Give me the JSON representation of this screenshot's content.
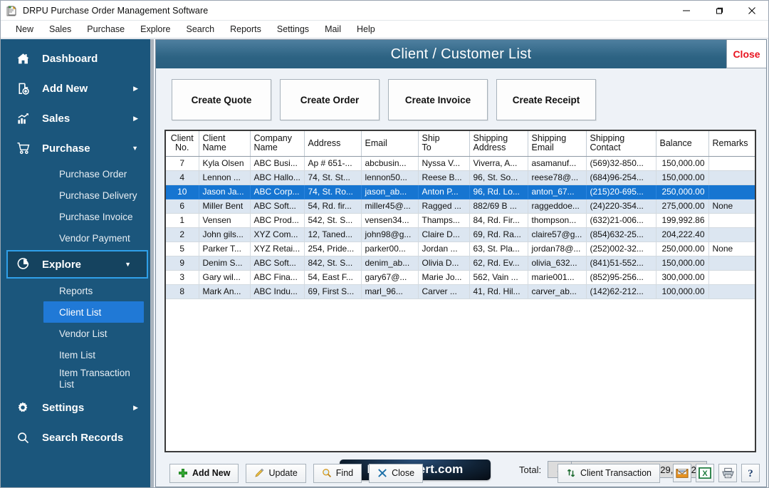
{
  "window": {
    "title": "DRPU Purchase Order Management Software",
    "app_icon": "app-icon",
    "minimize": "—",
    "maximize": "❐",
    "close": "✕"
  },
  "menubar": {
    "items": [
      {
        "label": "New"
      },
      {
        "label": "Sales"
      },
      {
        "label": "Purchase"
      },
      {
        "label": "Explore"
      },
      {
        "label": "Search"
      },
      {
        "label": "Reports"
      },
      {
        "label": "Settings"
      },
      {
        "label": "Mail"
      },
      {
        "label": "Help"
      }
    ]
  },
  "sidebar": {
    "items": [
      {
        "label": "Dashboard",
        "icon": "home-icon",
        "arrow": ""
      },
      {
        "label": "Add New",
        "icon": "file-plus-icon",
        "arrow": "▶"
      },
      {
        "label": "Sales",
        "icon": "bar-chart-icon",
        "arrow": "▶"
      },
      {
        "label": "Purchase",
        "icon": "cart-icon",
        "arrow": "▼"
      }
    ],
    "purchase_sub": [
      {
        "label": "Purchase Order"
      },
      {
        "label": "Purchase Delivery"
      },
      {
        "label": "Purchase Invoice"
      },
      {
        "label": "Vendor Payment"
      }
    ],
    "explore": {
      "label": "Explore",
      "icon": "pie-chart-icon",
      "arrow": "▼"
    },
    "explore_sub": [
      {
        "label": "Reports",
        "selected": false
      },
      {
        "label": "Client List",
        "selected": true
      },
      {
        "label": "Vendor List",
        "selected": false
      },
      {
        "label": "Item List",
        "selected": false
      },
      {
        "label": "Item Transaction",
        "label2": "List",
        "selected": false
      }
    ],
    "settings": {
      "label": "Settings",
      "icon": "gear-icon",
      "arrow": "▶"
    },
    "search_records": {
      "label": "Search Records",
      "icon": "search-icon"
    }
  },
  "panel": {
    "title": "Client / Customer List",
    "close_label": "Close"
  },
  "create_buttons": [
    {
      "label": "Create Quote"
    },
    {
      "label": "Create Order"
    },
    {
      "label": "Create Invoice"
    },
    {
      "label": "Create Receipt"
    }
  ],
  "grid": {
    "columns": [
      {
        "label": "Client No.",
        "l1": "Client",
        "l2": "No.",
        "align": "center"
      },
      {
        "label": "Client Name",
        "l1": "Client",
        "l2": "Name",
        "align": "left"
      },
      {
        "label": "Company Name",
        "l1": "Company",
        "l2": "Name",
        "align": "left"
      },
      {
        "label": "Address",
        "l1": "Address",
        "l2": "",
        "align": "left"
      },
      {
        "label": "Email",
        "l1": "Email",
        "l2": "",
        "align": "left"
      },
      {
        "label": "Ship To",
        "l1": "Ship",
        "l2": "To",
        "align": "left"
      },
      {
        "label": "Shipping Address",
        "l1": "Shipping",
        "l2": "Address",
        "align": "left"
      },
      {
        "label": "Shipping Email",
        "l1": "Shipping",
        "l2": "Email",
        "align": "left"
      },
      {
        "label": "Shipping Contact",
        "l1": "Shipping",
        "l2": "Contact",
        "align": "left"
      },
      {
        "label": "Balance",
        "l1": "Balance",
        "l2": "",
        "align": "left"
      },
      {
        "label": "Remarks",
        "l1": "Remarks",
        "l2": "",
        "align": "left"
      }
    ],
    "rows": [
      {
        "no": "7",
        "name": "Kyla Olsen",
        "company": "ABC Busi...",
        "address": "Ap # 651-...",
        "email": "abcbusin...",
        "ship_to": "Nyssa V...",
        "ship_addr": "Viverra, A...",
        "ship_email": "asamanuf...",
        "ship_contact": "(569)32-850...",
        "balance": "150,000.00",
        "remarks": "",
        "state": "even"
      },
      {
        "no": "4",
        "name": "Lennon ...",
        "company": "ABC Hallo...",
        "address": "74, St. St...",
        "email": "lennon50...",
        "ship_to": "Reese B...",
        "ship_addr": "96, St. So...",
        "ship_email": "reese78@...",
        "ship_contact": "(684)96-254...",
        "balance": "150,000.00",
        "remarks": "",
        "state": "odd"
      },
      {
        "no": "10",
        "name": "Jason Ja...",
        "company": "ABC Corp...",
        "address": "74, St. Ro...",
        "email": "jason_ab...",
        "ship_to": "Anton P...",
        "ship_addr": "96, Rd. Lo...",
        "ship_email": "anton_67...",
        "ship_contact": "(215)20-695...",
        "balance": "250,000.00",
        "remarks": "",
        "state": "sel"
      },
      {
        "no": "6",
        "name": "Miller Bent",
        "company": "ABC Soft...",
        "address": "54, Rd. fir...",
        "email": "miller45@...",
        "ship_to": "Ragged ...",
        "ship_addr": "882/69 B ...",
        "ship_email": "raggeddoe...",
        "ship_contact": "(24)220-354...",
        "balance": "275,000.00",
        "remarks": "None",
        "state": "odd"
      },
      {
        "no": "1",
        "name": "Vensen",
        "company": "ABC Prod...",
        "address": "542, St. S...",
        "email": "vensen34...",
        "ship_to": "Thamps...",
        "ship_addr": "84, Rd. Fir...",
        "ship_email": "thompson...",
        "ship_contact": "(632)21-006...",
        "balance": "199,992.86",
        "remarks": "",
        "state": "even"
      },
      {
        "no": "2",
        "name": "John gils...",
        "company": "XYZ Com...",
        "address": "12, Taned...",
        "email": "john98@g...",
        "ship_to": "Claire D...",
        "ship_addr": "69, Rd. Ra...",
        "ship_email": "claire57@g...",
        "ship_contact": "(854)632-25...",
        "balance": "204,222.40",
        "remarks": "",
        "state": "odd"
      },
      {
        "no": "5",
        "name": "Parker T...",
        "company": "XYZ Retai...",
        "address": "254, Pride...",
        "email": "parker00...",
        "ship_to": "Jordan ...",
        "ship_addr": "63, St. Pla...",
        "ship_email": "jordan78@...",
        "ship_contact": "(252)002-32...",
        "balance": "250,000.00",
        "remarks": "None",
        "state": "even"
      },
      {
        "no": "9",
        "name": "Denim S...",
        "company": "ABC Soft...",
        "address": "842, St. S...",
        "email": "denim_ab...",
        "ship_to": "Olivia D...",
        "ship_addr": "62, Rd. Ev...",
        "ship_email": "olivia_632...",
        "ship_contact": "(841)51-552...",
        "balance": "150,000.00",
        "remarks": "",
        "state": "odd"
      },
      {
        "no": "3",
        "name": "Gary wil...",
        "company": "ABC Fina...",
        "address": "54, East F...",
        "email": "gary67@...",
        "ship_to": "Marie Jo...",
        "ship_addr": "562,  Vain ...",
        "ship_email": "marie001...",
        "ship_contact": "(852)95-256...",
        "balance": "300,000.00",
        "remarks": "",
        "state": "even"
      },
      {
        "no": "8",
        "name": "Mark An...",
        "company": "ABC Indu...",
        "address": "69, First S...",
        "email": "marl_96...",
        "ship_to": "Carver ...",
        "ship_addr": "41, Rd. Hil...",
        "ship_email": "carver_ab...",
        "ship_contact": "(142)62-212...",
        "balance": "100,000.00",
        "remarks": "",
        "state": "odd"
      }
    ]
  },
  "footer": {
    "brand": "Db-Convert.com",
    "total_label": "Total:",
    "currency": "$",
    "total_value": "2,029,215.26"
  },
  "toolbar": {
    "add_new": "Add New",
    "update": "Update",
    "find": "Find",
    "close": "Close",
    "client_transaction": "Client Transaction",
    "icons": {
      "mail": "mail-icon",
      "excel": "excel-icon",
      "print": "print-icon",
      "help": "help-icon"
    }
  },
  "colors": {
    "sidebar_bg": "#1b567c",
    "header_blue": "#2d6383",
    "selection_blue": "#1675d1",
    "sub_selected": "#2079d6",
    "accent_outline": "#2f9fe8",
    "close_red": "#e8131f",
    "row_alt": "#dce6f1"
  }
}
